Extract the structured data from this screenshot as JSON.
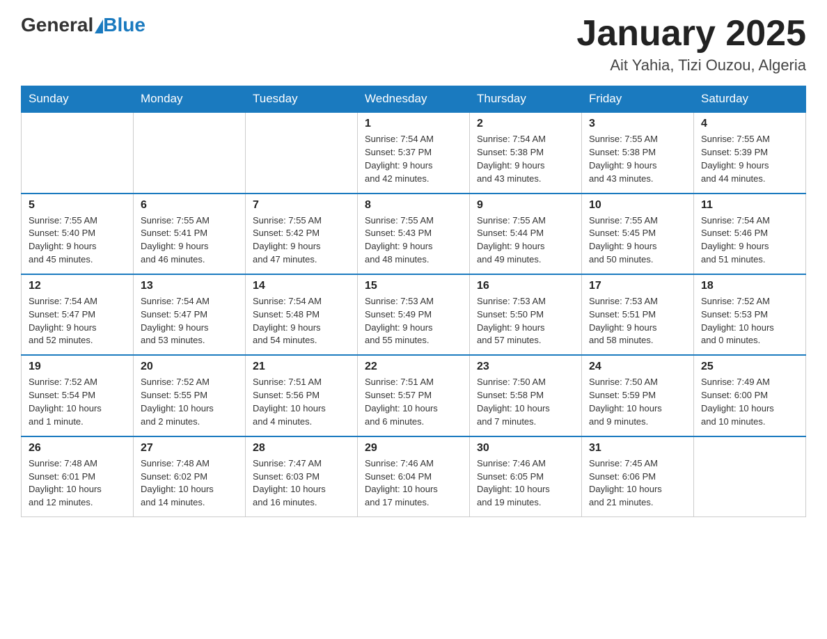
{
  "header": {
    "logo_general": "General",
    "logo_blue": "Blue",
    "month_title": "January 2025",
    "location": "Ait Yahia, Tizi Ouzou, Algeria"
  },
  "days_of_week": [
    "Sunday",
    "Monday",
    "Tuesday",
    "Wednesday",
    "Thursday",
    "Friday",
    "Saturday"
  ],
  "weeks": [
    [
      {
        "day": "",
        "info": ""
      },
      {
        "day": "",
        "info": ""
      },
      {
        "day": "",
        "info": ""
      },
      {
        "day": "1",
        "info": "Sunrise: 7:54 AM\nSunset: 5:37 PM\nDaylight: 9 hours\nand 42 minutes."
      },
      {
        "day": "2",
        "info": "Sunrise: 7:54 AM\nSunset: 5:38 PM\nDaylight: 9 hours\nand 43 minutes."
      },
      {
        "day": "3",
        "info": "Sunrise: 7:55 AM\nSunset: 5:38 PM\nDaylight: 9 hours\nand 43 minutes."
      },
      {
        "day": "4",
        "info": "Sunrise: 7:55 AM\nSunset: 5:39 PM\nDaylight: 9 hours\nand 44 minutes."
      }
    ],
    [
      {
        "day": "5",
        "info": "Sunrise: 7:55 AM\nSunset: 5:40 PM\nDaylight: 9 hours\nand 45 minutes."
      },
      {
        "day": "6",
        "info": "Sunrise: 7:55 AM\nSunset: 5:41 PM\nDaylight: 9 hours\nand 46 minutes."
      },
      {
        "day": "7",
        "info": "Sunrise: 7:55 AM\nSunset: 5:42 PM\nDaylight: 9 hours\nand 47 minutes."
      },
      {
        "day": "8",
        "info": "Sunrise: 7:55 AM\nSunset: 5:43 PM\nDaylight: 9 hours\nand 48 minutes."
      },
      {
        "day": "9",
        "info": "Sunrise: 7:55 AM\nSunset: 5:44 PM\nDaylight: 9 hours\nand 49 minutes."
      },
      {
        "day": "10",
        "info": "Sunrise: 7:55 AM\nSunset: 5:45 PM\nDaylight: 9 hours\nand 50 minutes."
      },
      {
        "day": "11",
        "info": "Sunrise: 7:54 AM\nSunset: 5:46 PM\nDaylight: 9 hours\nand 51 minutes."
      }
    ],
    [
      {
        "day": "12",
        "info": "Sunrise: 7:54 AM\nSunset: 5:47 PM\nDaylight: 9 hours\nand 52 minutes."
      },
      {
        "day": "13",
        "info": "Sunrise: 7:54 AM\nSunset: 5:47 PM\nDaylight: 9 hours\nand 53 minutes."
      },
      {
        "day": "14",
        "info": "Sunrise: 7:54 AM\nSunset: 5:48 PM\nDaylight: 9 hours\nand 54 minutes."
      },
      {
        "day": "15",
        "info": "Sunrise: 7:53 AM\nSunset: 5:49 PM\nDaylight: 9 hours\nand 55 minutes."
      },
      {
        "day": "16",
        "info": "Sunrise: 7:53 AM\nSunset: 5:50 PM\nDaylight: 9 hours\nand 57 minutes."
      },
      {
        "day": "17",
        "info": "Sunrise: 7:53 AM\nSunset: 5:51 PM\nDaylight: 9 hours\nand 58 minutes."
      },
      {
        "day": "18",
        "info": "Sunrise: 7:52 AM\nSunset: 5:53 PM\nDaylight: 10 hours\nand 0 minutes."
      }
    ],
    [
      {
        "day": "19",
        "info": "Sunrise: 7:52 AM\nSunset: 5:54 PM\nDaylight: 10 hours\nand 1 minute."
      },
      {
        "day": "20",
        "info": "Sunrise: 7:52 AM\nSunset: 5:55 PM\nDaylight: 10 hours\nand 2 minutes."
      },
      {
        "day": "21",
        "info": "Sunrise: 7:51 AM\nSunset: 5:56 PM\nDaylight: 10 hours\nand 4 minutes."
      },
      {
        "day": "22",
        "info": "Sunrise: 7:51 AM\nSunset: 5:57 PM\nDaylight: 10 hours\nand 6 minutes."
      },
      {
        "day": "23",
        "info": "Sunrise: 7:50 AM\nSunset: 5:58 PM\nDaylight: 10 hours\nand 7 minutes."
      },
      {
        "day": "24",
        "info": "Sunrise: 7:50 AM\nSunset: 5:59 PM\nDaylight: 10 hours\nand 9 minutes."
      },
      {
        "day": "25",
        "info": "Sunrise: 7:49 AM\nSunset: 6:00 PM\nDaylight: 10 hours\nand 10 minutes."
      }
    ],
    [
      {
        "day": "26",
        "info": "Sunrise: 7:48 AM\nSunset: 6:01 PM\nDaylight: 10 hours\nand 12 minutes."
      },
      {
        "day": "27",
        "info": "Sunrise: 7:48 AM\nSunset: 6:02 PM\nDaylight: 10 hours\nand 14 minutes."
      },
      {
        "day": "28",
        "info": "Sunrise: 7:47 AM\nSunset: 6:03 PM\nDaylight: 10 hours\nand 16 minutes."
      },
      {
        "day": "29",
        "info": "Sunrise: 7:46 AM\nSunset: 6:04 PM\nDaylight: 10 hours\nand 17 minutes."
      },
      {
        "day": "30",
        "info": "Sunrise: 7:46 AM\nSunset: 6:05 PM\nDaylight: 10 hours\nand 19 minutes."
      },
      {
        "day": "31",
        "info": "Sunrise: 7:45 AM\nSunset: 6:06 PM\nDaylight: 10 hours\nand 21 minutes."
      },
      {
        "day": "",
        "info": ""
      }
    ]
  ]
}
